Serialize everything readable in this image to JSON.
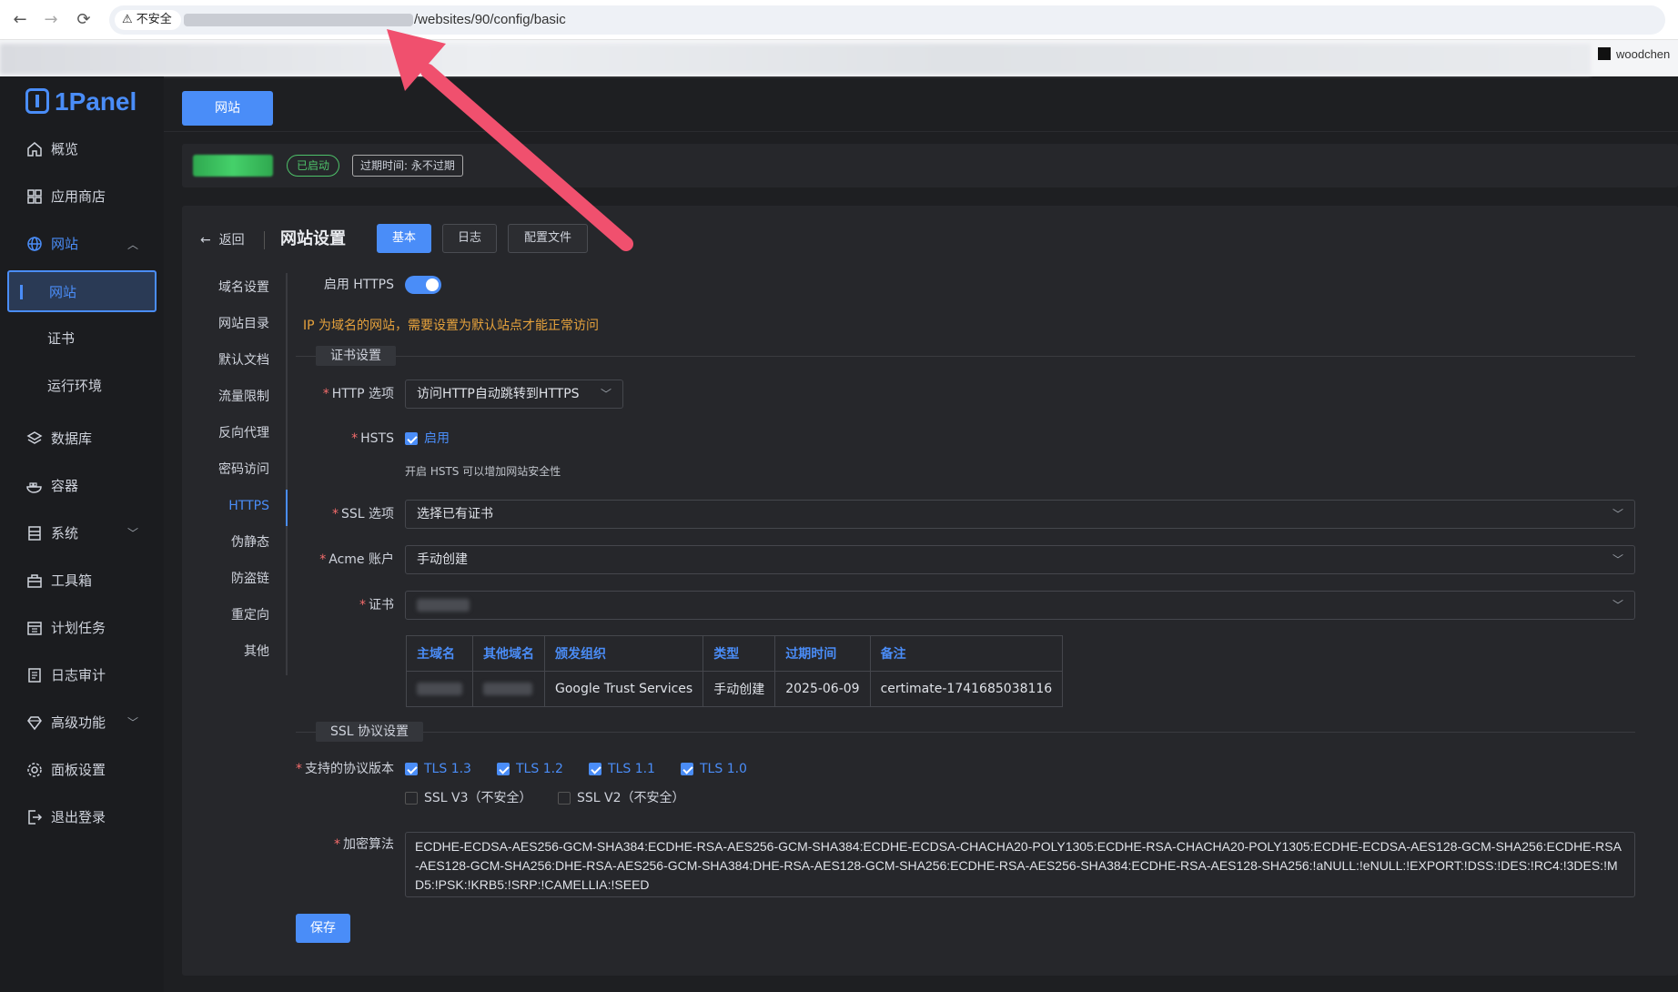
{
  "browser": {
    "back": "←",
    "forward": "→",
    "reload": "⟳",
    "insecure": "⚠ 不安全",
    "url_tail": "/websites/90/config/basic",
    "user": "woodchen"
  },
  "sidebar": {
    "logo": "1Panel",
    "items": [
      {
        "label": "概览",
        "icon": "home-icon"
      },
      {
        "label": "应用商店",
        "icon": "grid-icon"
      },
      {
        "label": "网站",
        "icon": "globe-icon",
        "expanded": true
      },
      {
        "label": "数据库",
        "icon": "layers-icon"
      },
      {
        "label": "容器",
        "icon": "docker-icon"
      },
      {
        "label": "系统",
        "icon": "server-icon"
      },
      {
        "label": "工具箱",
        "icon": "toolbox-icon"
      },
      {
        "label": "计划任务",
        "icon": "calendar-icon"
      },
      {
        "label": "日志审计",
        "icon": "log-icon"
      },
      {
        "label": "高级功能",
        "icon": "diamond-icon"
      },
      {
        "label": "面板设置",
        "icon": "gear-icon"
      },
      {
        "label": "退出登录",
        "icon": "logout-icon"
      }
    ],
    "sub_items": [
      "网站",
      "证书",
      "运行环境"
    ]
  },
  "top_tab": "网站",
  "status": {
    "running": "已启动",
    "expire": "过期时间: 永不过期"
  },
  "card": {
    "back": "返回",
    "title": "网站设置",
    "tabs": [
      "基本",
      "日志",
      "配置文件"
    ]
  },
  "settings_nav": [
    "域名设置",
    "网站目录",
    "默认文档",
    "流量限制",
    "反向代理",
    "密码访问",
    "HTTPS",
    "伪静态",
    "防盗链",
    "重定向",
    "其他"
  ],
  "form": {
    "https_label": "启用 HTTPS",
    "warning": "IP 为域名的网站，需要设置为默认站点才能正常访问",
    "cert_section": "证书设置",
    "http_option_label": "HTTP 选项",
    "http_option_value": "访问HTTP自动跳转到HTTPS",
    "hsts_label": "HSTS",
    "hsts_check": "启用",
    "hsts_hint": "开启 HSTS 可以增加网站安全性",
    "ssl_option_label": "SSL 选项",
    "ssl_option_value": "选择已有证书",
    "acme_label": "Acme 账户",
    "acme_value": "手动创建",
    "cert_label": "证书",
    "table_headers": [
      "主域名",
      "其他域名",
      "颁发组织",
      "类型",
      "过期时间",
      "备注"
    ],
    "table_row": {
      "issuer": "Google Trust Services",
      "type": "手动创建",
      "expire": "2025-06-09",
      "remark": "certimate-1741685038116"
    },
    "protocol_section": "SSL 协议设置",
    "protocol_label": "支持的协议版本",
    "protocols_on": [
      "TLS 1.3",
      "TLS 1.2",
      "TLS 1.1",
      "TLS 1.0"
    ],
    "protocols_off": [
      "SSL V3（不安全）",
      "SSL V2（不安全）"
    ],
    "cipher_label": "加密算法",
    "cipher_value": "ECDHE-ECDSA-AES256-GCM-SHA384:ECDHE-RSA-AES256-GCM-SHA384:ECDHE-ECDSA-CHACHA20-POLY1305:ECDHE-RSA-CHACHA20-POLY1305:ECDHE-ECDSA-AES128-GCM-SHA256:ECDHE-RSA-AES128-GCM-SHA256:DHE-RSA-AES256-GCM-SHA384:DHE-RSA-AES128-GCM-SHA256:ECDHE-RSA-AES256-SHA384:ECDHE-RSA-AES128-SHA256:!aNULL:!eNULL:!EXPORT:!DSS:!DES:!RC4:!3DES:!MD5:!PSK:!KRB5:!SRP:!CAMELLIA:!SEED",
    "save": "保存",
    "required_mark": "*",
    "chevron": "﹀"
  },
  "colors": {
    "accent": "#4a8df8",
    "success": "#4ec26a",
    "warning": "#e6a23c",
    "annotation_arrow": "#f0506e"
  }
}
